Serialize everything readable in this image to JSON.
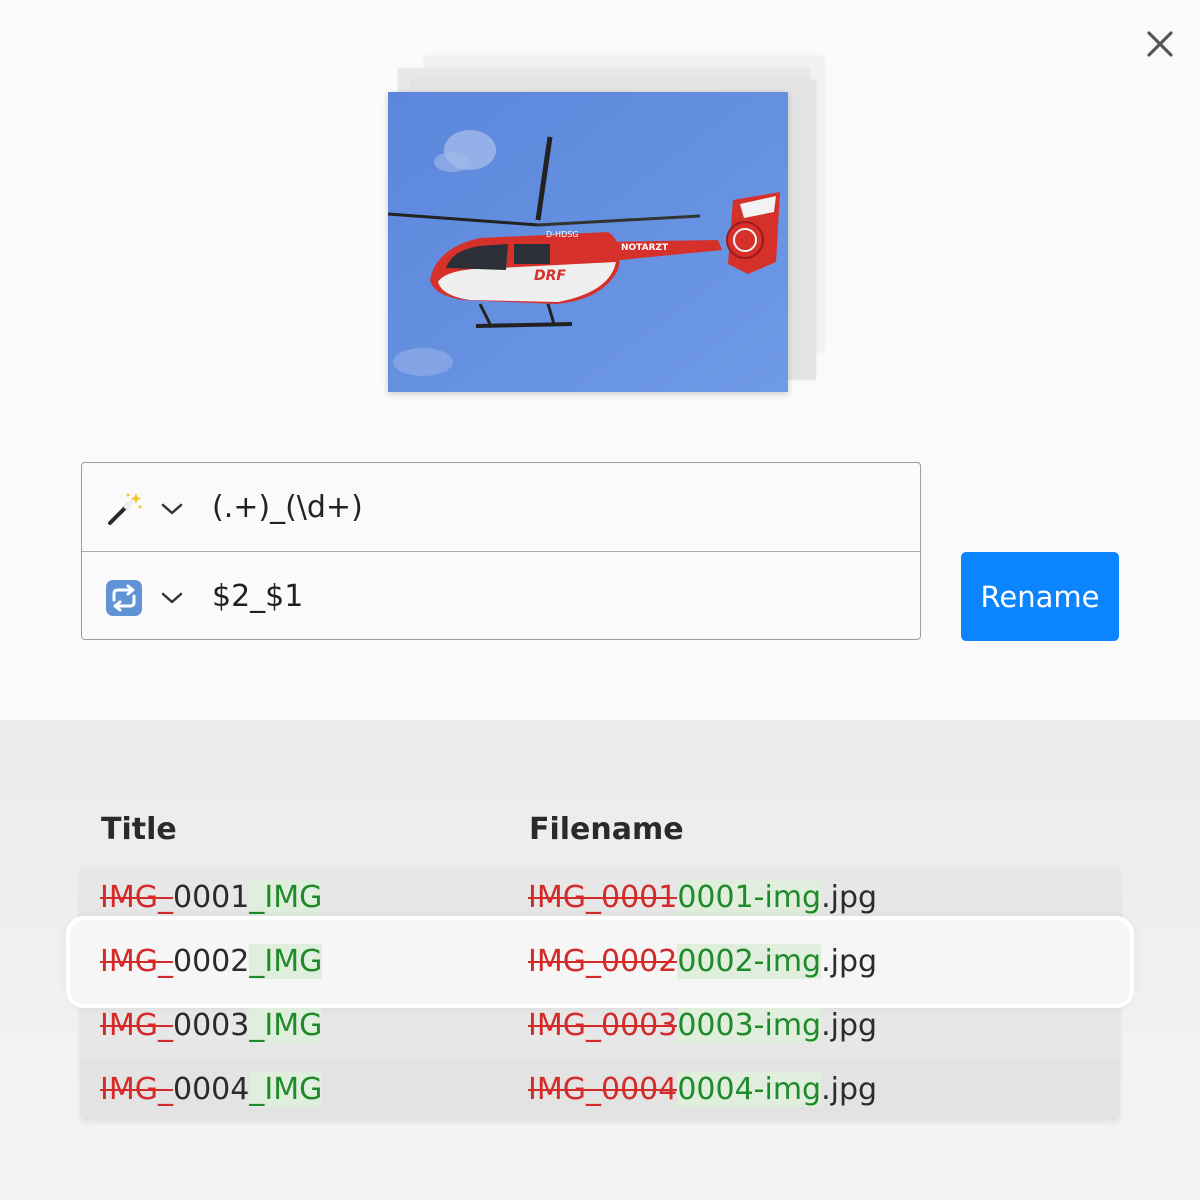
{
  "window": {
    "close_label": "close"
  },
  "preview": {
    "photo_subject": "helicopter",
    "decals": [
      "D-HDSG",
      "NOTARZT",
      "DRF"
    ]
  },
  "find": {
    "icon": "magic-wand-icon",
    "value": "(.+)_(\\d+)"
  },
  "replace": {
    "icon": "repeat-arrows-icon",
    "value": "$2_$1"
  },
  "rename_button": "Rename",
  "table": {
    "headers": {
      "title": "Title",
      "filename": "Filename"
    },
    "rows": [
      {
        "title_removed": "IMG_",
        "title_kept": "0001",
        "title_added": "_IMG",
        "file_removed": "IMG_0001",
        "file_added": "0001-img",
        "file_ext": ".jpg"
      },
      {
        "title_removed": "IMG_",
        "title_kept": "0002",
        "title_added": "_IMG",
        "file_removed": "IMG_0002",
        "file_added": "0002-img",
        "file_ext": ".jpg"
      },
      {
        "title_removed": "IMG_",
        "title_kept": "0003",
        "title_added": "_IMG",
        "file_removed": "IMG_0003",
        "file_added": "0003-img",
        "file_ext": ".jpg"
      },
      {
        "title_removed": "IMG_",
        "title_kept": "0004",
        "title_added": "_IMG",
        "file_removed": "IMG_0004",
        "file_added": "0004-img",
        "file_ext": ".jpg"
      }
    ]
  },
  "colors": {
    "accent": "#0a84ff",
    "removed": "#d42a2a",
    "added": "#1f8a2a",
    "added_bg": "#dfeedd"
  }
}
